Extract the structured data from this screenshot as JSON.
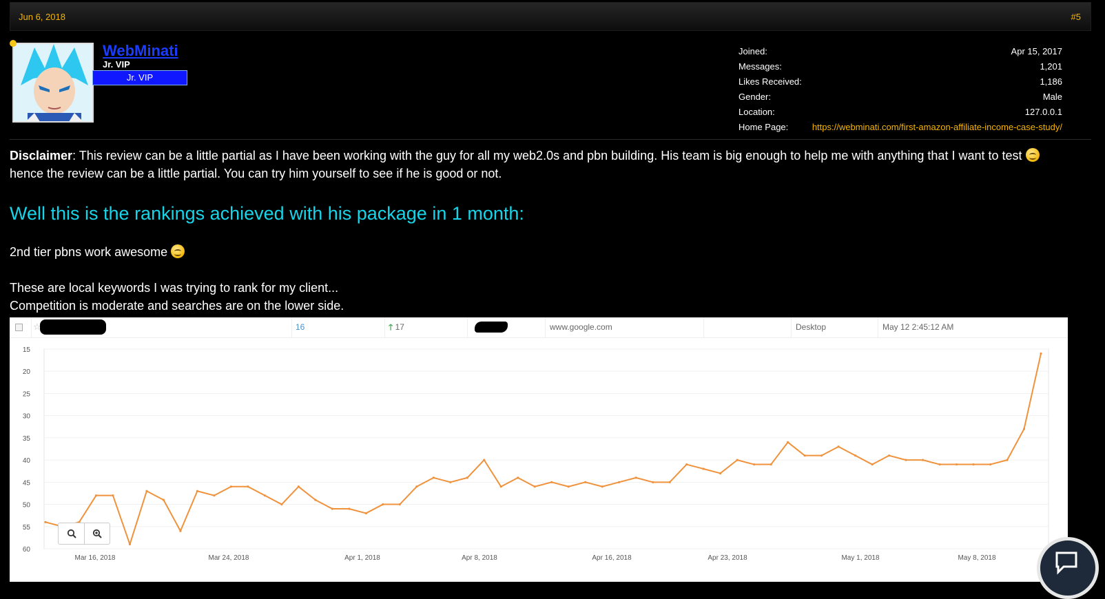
{
  "post": {
    "date": "Jun 6, 2018",
    "number": "#5"
  },
  "user": {
    "username": "WebMinati",
    "title": "Jr. VIP",
    "banner": "Jr. VIP",
    "info": [
      {
        "label": "Joined:",
        "value": "Apr 15, 2017"
      },
      {
        "label": "Messages:",
        "value": "1,201"
      },
      {
        "label": "Likes Received:",
        "value": "1,186"
      },
      {
        "label": "Gender:",
        "value": "Male"
      },
      {
        "label": "Location:",
        "value": "127.0.0.1"
      },
      {
        "label": "Home Page:",
        "value": "https://webminati.com/first-amazon-affiliate-income-case-study/"
      }
    ]
  },
  "message": {
    "disclaimer_label": "Disclaimer",
    "disclaimer_text": ": This review can be a little partial as I have been working with the guy for all my web2.0s and pbn building. His team is big enough to help me with anything that I want to test",
    "disclaimer_text2": "hence the review can be a little partial. You can try him yourself to see if he is good or not.",
    "heading": "Well this is the rankings achieved with his package in 1 month:",
    "line_pbns": "2nd tier pbns work awesome",
    "line_local1": "These are local keywords I was trying to rank for my client...",
    "line_local2": "Competition is moderate and searches are on the lower side."
  },
  "tracker_row": {
    "current_rank": "16",
    "change": "17",
    "engine": "www.google.com",
    "device": "Desktop",
    "checked": "May 12 2:45:12 AM"
  },
  "colors": {
    "line": "#f0923c",
    "accent": "#f7b500",
    "heading": "#17d4e8"
  },
  "chart_data": {
    "type": "line",
    "y_inverted": true,
    "ylim": [
      15,
      60
    ],
    "y_ticks": [
      15,
      20,
      25,
      30,
      35,
      40,
      45,
      50,
      55,
      60
    ],
    "x_labels": [
      "Mar 16, 2018",
      "Mar 24, 2018",
      "Apr 1, 2018",
      "Apr 8, 2018",
      "Apr 16, 2018",
      "Apr 23, 2018",
      "May 1, 2018",
      "May 8, 2018"
    ],
    "grid": true,
    "series": [
      {
        "values": [
          54,
          55,
          54,
          48,
          48,
          59,
          47,
          49,
          56,
          47,
          48,
          46,
          46,
          48,
          50,
          46,
          49,
          51,
          51,
          52,
          50,
          50,
          46,
          44,
          45,
          44,
          40,
          46,
          44,
          46,
          45,
          46,
          45,
          46,
          45,
          44,
          45,
          45,
          41,
          42,
          43,
          40,
          41,
          41,
          36,
          39,
          39,
          37,
          39,
          41,
          39,
          40,
          40,
          41,
          41,
          41,
          41,
          40,
          33,
          16
        ]
      }
    ]
  }
}
